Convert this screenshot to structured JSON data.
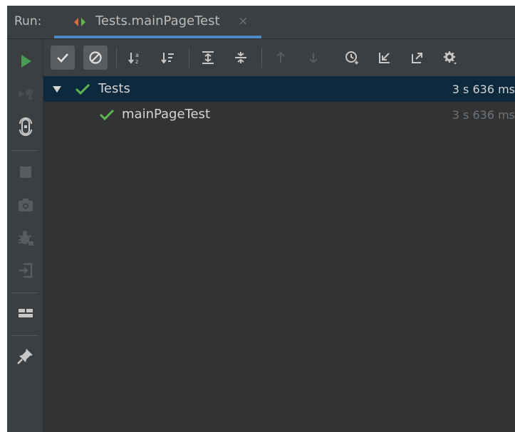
{
  "run_panel": {
    "label": "Run:",
    "tab": {
      "title": "Tests.mainPageTest",
      "close_glyph": "×"
    }
  },
  "colors": {
    "success": "#5fb54f",
    "run_green": "#499c54",
    "selection": "#0d293e",
    "tab_underline": "#4a88c7"
  },
  "sidebar": [
    {
      "icon": "run-icon",
      "enabled": true
    },
    {
      "icon": "rerun-failed-icon",
      "enabled": false
    },
    {
      "icon": "toggle-auto-test-icon",
      "enabled": true
    },
    {
      "icon": "stop-icon",
      "enabled": false
    },
    {
      "icon": "camera-icon",
      "enabled": false
    },
    {
      "icon": "debug-icon",
      "enabled": false
    },
    {
      "icon": "exit-icon",
      "enabled": false
    },
    {
      "icon": "layout-icon",
      "enabled": true
    },
    {
      "icon": "pin-icon",
      "enabled": true
    }
  ],
  "toolbar": [
    {
      "icon": "show-passed-icon",
      "active": true
    },
    {
      "icon": "show-ignored-icon",
      "active": true
    },
    {
      "icon": "sort-alphabetically-icon",
      "active": false
    },
    {
      "icon": "sort-by-duration-icon",
      "active": false
    },
    {
      "icon": "expand-all-icon",
      "active": false
    },
    {
      "icon": "collapse-all-icon",
      "active": false
    },
    {
      "icon": "previous-failed-icon",
      "active": false
    },
    {
      "icon": "next-failed-icon",
      "active": false
    },
    {
      "icon": "test-history-icon",
      "active": false
    },
    {
      "icon": "import-tests-icon",
      "active": false
    },
    {
      "icon": "export-results-icon",
      "active": false
    },
    {
      "icon": "settings-icon",
      "active": false
    }
  ],
  "tests": {
    "root": {
      "name": "Tests",
      "status": "passed",
      "duration": "3 s 636 ms",
      "expanded": true
    },
    "children": [
      {
        "name": "mainPageTest",
        "status": "passed",
        "duration": "3 s 636 ms"
      }
    ]
  }
}
